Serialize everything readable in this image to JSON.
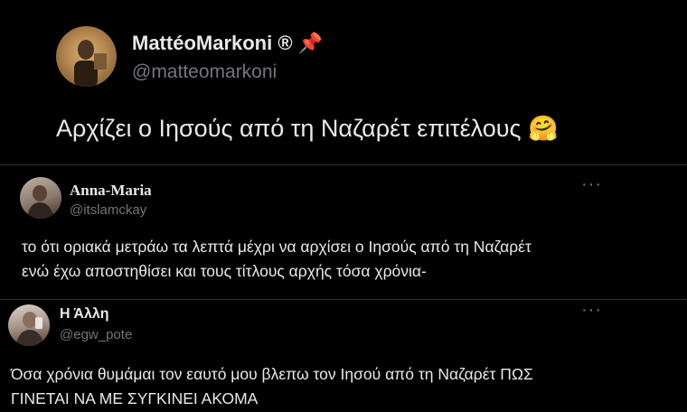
{
  "main_tweet": {
    "name": "MattéoMarkoni ®",
    "pin_emoji": "📌",
    "handle": "@matteomarkoni",
    "text": "Αρχίζει ο Ιησούς από τη Ναζαρέτ επιτέλους",
    "emoji": "🤗"
  },
  "reply_1": {
    "name": "Anna-Maria",
    "handle": "@itslamckay",
    "more": "···",
    "line1": "το ότι οριακά μετράω τα λεπτά μέχρι να αρχίσει ο Ιησούς από τη Ναζαρέτ",
    "line2": "ενώ έχω αποστηθίσει και τους τίτλους αρχής τόσα χρόνια-"
  },
  "reply_2": {
    "name": "Η Άλλη",
    "handle": "@egw_pote",
    "more": "···",
    "line1": "Όσα χρόνια θυμάμαι τον εαυτό μου βλεπω τον Ιησού από τη Ναζαρέτ ΠΩΣ",
    "line2": "ΓΙΝΕΤΑΙ ΝΑ ΜΕ ΣΥΓΚΙΝΕΙ ΑΚΟΜΑ"
  },
  "colors": {
    "background": "#000000",
    "text": "#e7e9ea",
    "secondary": "#71767b",
    "divider": "#2f3336"
  }
}
